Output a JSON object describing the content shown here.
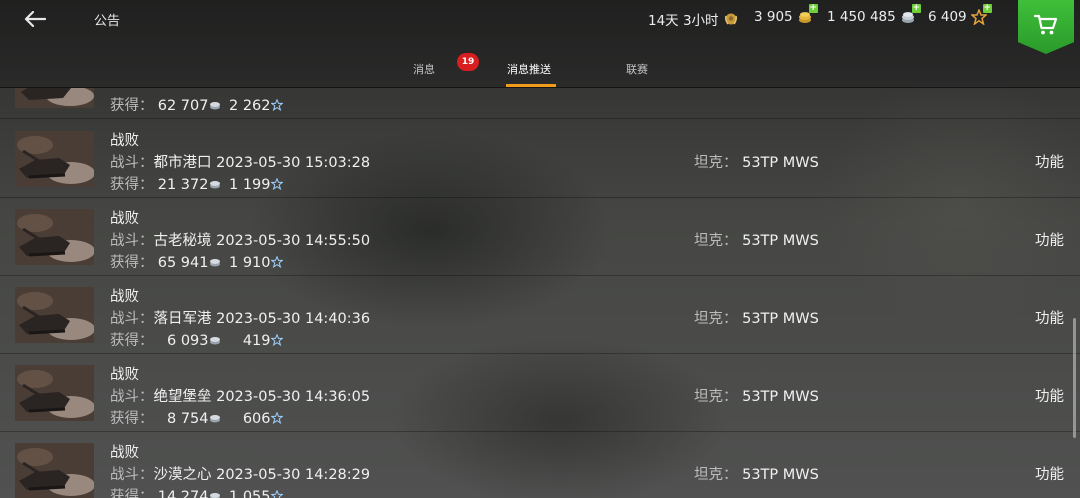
{
  "header": {
    "title": "公告",
    "back_icon": "back-arrow-icon",
    "premium_time": "14天 3小时",
    "gold": "3 905",
    "credits": "1 450 485",
    "free_xp": "6 409",
    "shop_icon": "shopping-cart-icon"
  },
  "tabs": [
    {
      "label": "消息",
      "badge": "19"
    },
    {
      "label": "消息推送"
    },
    {
      "label": "联赛"
    }
  ],
  "active_tab": "消息推送",
  "colors": {
    "accent": "#f29a1a",
    "badge": "#d81e1e",
    "shop": "#3fbf3a",
    "plus": "#6fcf3a"
  },
  "labels": {
    "battle": "战斗：",
    "reward": "获得：",
    "tank": "坦克：",
    "action": "功能"
  },
  "partial_row": {
    "credits": "62 707",
    "xp": "2 262"
  },
  "rows": [
    {
      "result": "战败",
      "map": "都市港口",
      "datetime": "2023-05-30 15:03:28",
      "credits": "21 372",
      "xp": "1 199",
      "tank": "53TP MWS"
    },
    {
      "result": "战败",
      "map": "古老秘境",
      "datetime": "2023-05-30 14:55:50",
      "credits": "65 941",
      "xp": "1 910",
      "tank": "53TP MWS"
    },
    {
      "result": "战败",
      "map": "落日军港",
      "datetime": "2023-05-30 14:40:36",
      "credits": "6 093",
      "xp": "419",
      "tank": "53TP MWS"
    },
    {
      "result": "战败",
      "map": "绝望堡垒",
      "datetime": "2023-05-30 14:36:05",
      "credits": "8 754",
      "xp": "606",
      "tank": "53TP MWS"
    },
    {
      "result": "战败",
      "map": "沙漠之心",
      "datetime": "2023-05-30 14:28:29",
      "credits": "14 274",
      "xp": "1 055",
      "tank": "53TP MWS"
    }
  ]
}
